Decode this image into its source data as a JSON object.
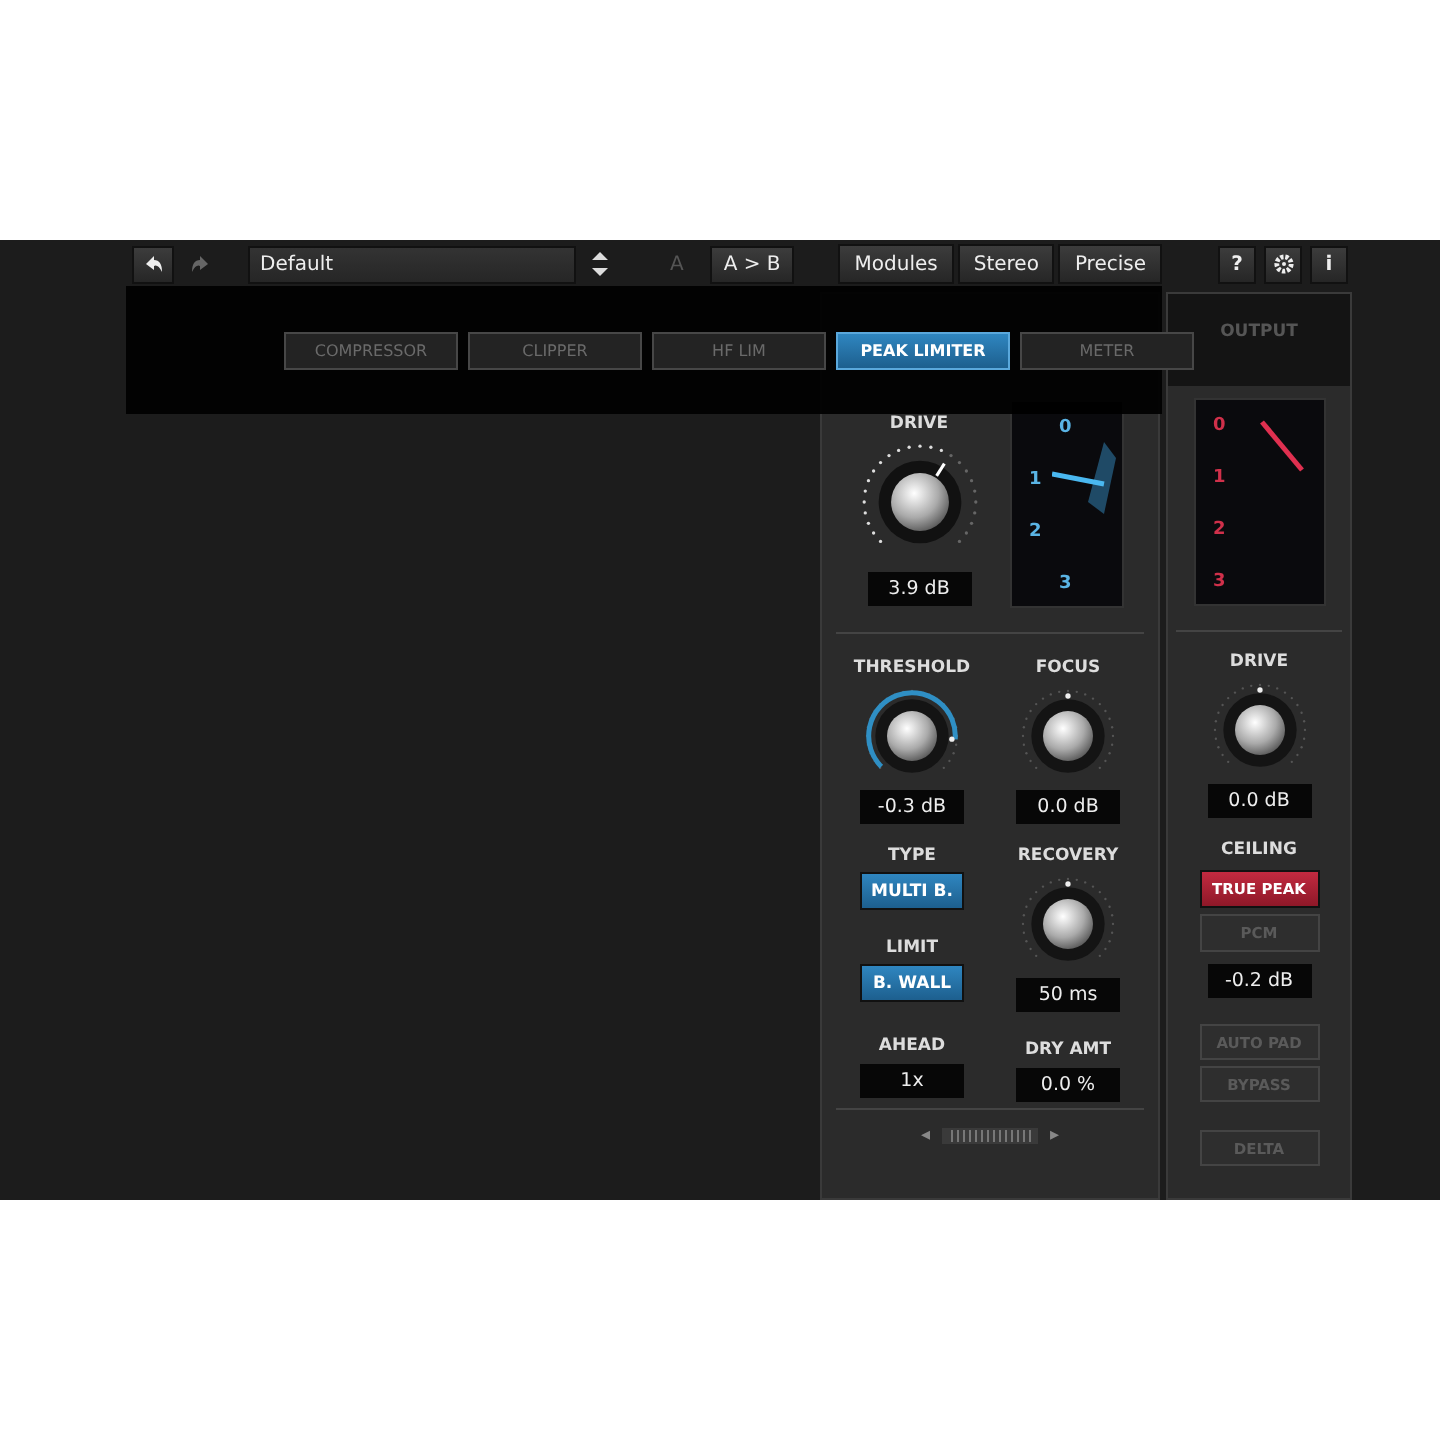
{
  "toolbar": {
    "preset": "Default",
    "compare": [
      {
        "label": "A",
        "disabled": true
      },
      {
        "label": "A > B",
        "disabled": false
      }
    ],
    "modes": [
      "Modules",
      "Stereo",
      "Precise"
    ],
    "utility": [
      {
        "kind": "text",
        "label": "?"
      },
      {
        "kind": "gear"
      },
      {
        "kind": "text",
        "label": "i"
      }
    ]
  },
  "module_tabs": [
    {
      "label": "COMPRESSOR",
      "selected": false
    },
    {
      "label": "CLIPPER",
      "selected": false
    },
    {
      "label": "HF LIM",
      "selected": false
    },
    {
      "label": "PEAK LIMITER",
      "selected": true
    },
    {
      "label": "METER",
      "selected": false
    }
  ],
  "limiter": {
    "drive": {
      "label": "DRIVE",
      "value": "3.9 dB"
    },
    "meter": {
      "scale": [
        "0",
        "1",
        "2",
        "3"
      ]
    },
    "columns": [
      [
        {
          "kind": "knob",
          "label": "THRESHOLD",
          "arc": true,
          "value": "-0.3 dB"
        },
        {
          "kind": "toggle",
          "label": "TYPE",
          "button": "MULTI B.",
          "on": true
        },
        {
          "kind": "toggle",
          "label": "LIMIT",
          "button": "B. WALL",
          "on": true
        },
        {
          "kind": "readout",
          "label": "AHEAD",
          "value": "1x"
        }
      ],
      [
        {
          "kind": "knob",
          "label": "FOCUS",
          "arc": false,
          "value": "0.0 dB"
        },
        {
          "kind": "knob",
          "label": "RECOVERY",
          "arc": false,
          "value": "50 ms"
        },
        {
          "kind": "readout",
          "label": "DRY AMT",
          "value": "0.0 %"
        }
      ]
    ],
    "scroller": {
      "left": "◂",
      "right": "▸"
    }
  },
  "output": {
    "label": "OUTPUT",
    "meter": {
      "scale": [
        "0",
        "1",
        "2",
        "3"
      ]
    },
    "drive": {
      "label": "DRIVE",
      "value": "0.0 dB"
    },
    "ceiling": {
      "label": "CEILING",
      "options": [
        {
          "label": "TRUE PEAK",
          "selected": true
        },
        {
          "label": "PCM",
          "selected": false
        }
      ],
      "value": "-0.2 dB"
    },
    "switches": [
      {
        "label": "AUTO PAD",
        "on": false
      },
      {
        "label": "BYPASS",
        "on": false
      },
      {
        "label": "DELTA",
        "on": false
      }
    ]
  }
}
